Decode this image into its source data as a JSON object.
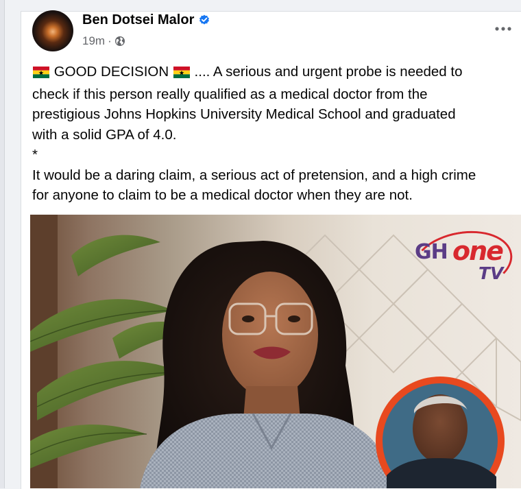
{
  "post": {
    "author": "Ben Dotsei Malor",
    "timestamp": "19m",
    "separator": "·",
    "text_line1": "GOOD DECISION",
    "text_line1_dots": "....",
    "text_line1_rest": "A serious and urgent probe is needed to",
    "text_line2": "check if this person really qualified as a medical doctor from the",
    "text_line3": "prestigious Johns Hopkins University Medical School and graduated",
    "text_line4": "with a solid GPA of 4.0.",
    "text_line5": "*",
    "text_line6": "It would be a daring claim, a serious act of pretension, and a high crime",
    "text_line7": "for anyone to claim to be a medical doctor when they are not."
  },
  "image": {
    "watermark_gh": "GH",
    "watermark_one": "one",
    "watermark_tv": "TV"
  },
  "icons": {
    "verified": "verified-badge-icon",
    "privacy": "globe-icon",
    "more": "more-options-icon",
    "flag": "ghana-flag-emoji"
  },
  "colors": {
    "text_primary": "#050505",
    "text_secondary": "#65676b",
    "verified_blue": "#1877f2",
    "watermark_red": "#d8282e",
    "watermark_purple": "#5b3c86",
    "ghana_red": "#ce1126",
    "ghana_gold": "#fcd116",
    "ghana_green": "#006b3f"
  }
}
